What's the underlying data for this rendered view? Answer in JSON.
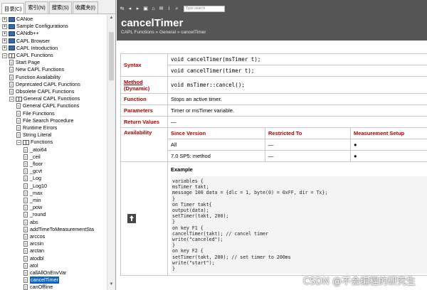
{
  "nav": {
    "tabs": [
      "目录(C)",
      "索引(N)",
      "搜索(S)",
      "收藏夹(I)"
    ],
    "items": [
      {
        "label": "CANoe",
        "kind": "book",
        "expanded": false
      },
      {
        "label": "Sample Configurations",
        "kind": "book",
        "expanded": false
      },
      {
        "label": "CANdb++",
        "kind": "book",
        "expanded": false
      },
      {
        "label": "CAPL Browser",
        "kind": "book",
        "expanded": false
      },
      {
        "label": "CAPL Introduction",
        "kind": "book",
        "expanded": false
      },
      {
        "label": "CAPL Functions",
        "kind": "book",
        "expanded": true
      },
      {
        "label": "Start Page",
        "kind": "page"
      },
      {
        "label": "New CAPL Functions",
        "kind": "page"
      },
      {
        "label": "Function Availability",
        "kind": "page"
      },
      {
        "label": "Deprecated CAPL Functions",
        "kind": "page"
      },
      {
        "label": "Obsolete CAPL Functions",
        "kind": "page"
      },
      {
        "label": "General CAPL Functions",
        "kind": "book",
        "expanded": true
      },
      {
        "label": "General CAPL Functions",
        "kind": "page"
      },
      {
        "label": "File Functions",
        "kind": "page"
      },
      {
        "label": "File Search Procedure",
        "kind": "page"
      },
      {
        "label": "Runtime Errors",
        "kind": "page"
      },
      {
        "label": "String Literal",
        "kind": "page"
      },
      {
        "label": "Functions",
        "kind": "book",
        "expanded": true
      },
      {
        "label": "_atoi64",
        "kind": "page"
      },
      {
        "label": "_ceil",
        "kind": "page"
      },
      {
        "label": "_floor",
        "kind": "page"
      },
      {
        "label": "_gcvt",
        "kind": "page"
      },
      {
        "label": "_Log",
        "kind": "page"
      },
      {
        "label": "_Log10",
        "kind": "page"
      },
      {
        "label": "_max",
        "kind": "page"
      },
      {
        "label": "_min",
        "kind": "page"
      },
      {
        "label": "_pow",
        "kind": "page"
      },
      {
        "label": "_round",
        "kind": "page"
      },
      {
        "label": "abs",
        "kind": "page"
      },
      {
        "label": "addTimeToMeasurementSta",
        "kind": "page"
      },
      {
        "label": "arccos",
        "kind": "page"
      },
      {
        "label": "arcsin",
        "kind": "page"
      },
      {
        "label": "arctan",
        "kind": "page"
      },
      {
        "label": "atodbl",
        "kind": "page"
      },
      {
        "label": "atol",
        "kind": "page"
      },
      {
        "label": "callAllOnEnvVar",
        "kind": "page"
      },
      {
        "label": "cancelTimer",
        "kind": "page",
        "selected": true
      },
      {
        "label": "canOffline",
        "kind": "page"
      }
    ]
  },
  "toolbar": {
    "search_placeholder": "Type search"
  },
  "page": {
    "title": "cancelTimer",
    "breadcrumb": "CAPL Functions » General » cancelTimer"
  },
  "ref": {
    "syntax_label": "Syntax",
    "syntax_1": "void cancelTimer(msTimer t);",
    "syntax_2": "void cancelTimer(timer t);",
    "method_label": "Method",
    "method_sub": "(Dynamic)",
    "method_value": "void msTimer::cancel();",
    "function_label": "Function",
    "function_value": "Stops an active timer.",
    "parameters_label": "Parameters",
    "parameters_value": "Timer or msTimer variable.",
    "return_label": "Return Values",
    "return_value": "—",
    "availability_label": "Availability",
    "avail_headers": [
      "Since Version",
      "Restricted To",
      "Measurement Setup"
    ],
    "avail_rows": [
      [
        "All",
        "—",
        "●"
      ],
      [
        "7.0 SP5: method",
        "—",
        "●"
      ]
    ],
    "example_label": "Example",
    "example_code": "variables {\nmsTimer takt;\nmessage 100 data = {dlc = 1, byte(0) = 0xFF, dir = Tx};\n}\non Timer takt{\noutput(data);\nsetTimer(takt, 200);\n}\non key F1 {\ncancelTimer(takt); // cancel timer\nwrite(\"canceled\");\n}\non key F2 {\nsetTimer(takt, 200); // set timer to 200ms\nwrite(\"start\");\n}"
  },
  "watermark": "CSDN @不会编程的研究生"
}
